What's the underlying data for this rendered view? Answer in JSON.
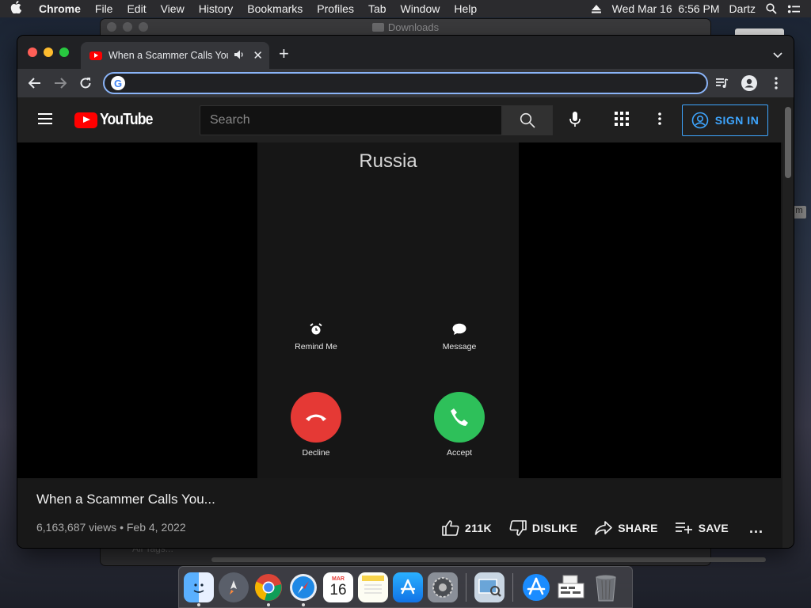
{
  "menubar": {
    "app_name": "Chrome",
    "menus": [
      "File",
      "Edit",
      "View",
      "History",
      "Bookmarks",
      "Profiles",
      "Tab",
      "Window",
      "Help"
    ],
    "clock": "Wed Mar 16  6:56 PM",
    "user": "Dartz"
  },
  "finder_window": {
    "title": "Downloads",
    "sidebar_item": "All Tags..."
  },
  "desktop_label": "m",
  "browser": {
    "tab": {
      "title": "When a Scammer Calls You",
      "audio_icon": "speaker-icon",
      "close": "✕"
    },
    "new_tab": "+",
    "omnibox": {
      "value": "",
      "placeholder": ""
    }
  },
  "youtube": {
    "logo_text": "YouTube",
    "search_placeholder": "Search",
    "sign_in": "SIGN IN",
    "video": {
      "caller_name": "Russia",
      "remind_me": "Remind Me",
      "message": "Message",
      "decline": "Decline",
      "accept": "Accept",
      "title": "When a Scammer Calls You...",
      "views": "6,163,687 views",
      "date": "Feb 4, 2022",
      "meta_separator": "•",
      "likes": "211K",
      "dislike": "DISLIKE",
      "share": "SHARE",
      "save": "SAVE",
      "more": "..."
    }
  },
  "dock": {
    "calendar_month": "MAR",
    "calendar_day": "16",
    "apps": [
      "finder-icon",
      "launchpad-icon",
      "chrome-icon",
      "safari-icon",
      "calendar-icon",
      "notes-icon",
      "app-store-icon",
      "system-preferences-icon",
      "preview-icon",
      "app-store-folder-icon",
      "documents-icon",
      "trash-icon"
    ]
  },
  "colors": {
    "youtube_red": "#ff0000",
    "accent_blue": "#3ea6ff",
    "decline_red": "#e53935",
    "accept_green": "#2ec05a",
    "omnibox_focus": "#8ab4f8"
  }
}
